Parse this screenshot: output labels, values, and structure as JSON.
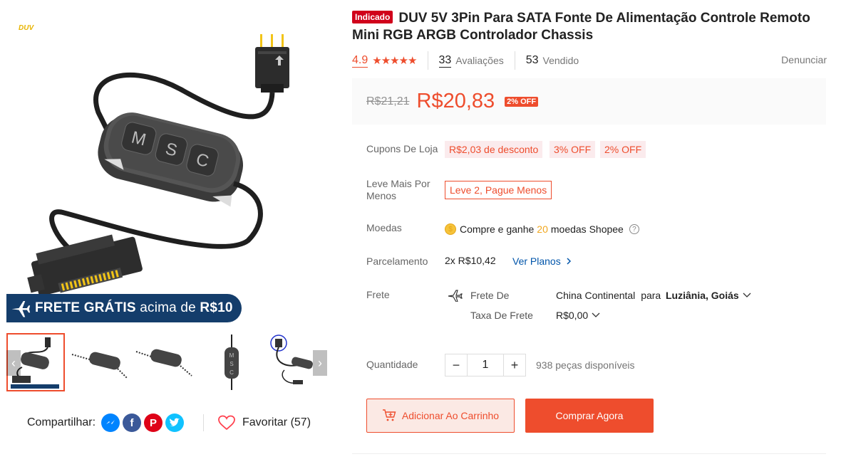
{
  "gallery": {
    "watermark": "DUV",
    "banner": {
      "strong": "FRETE GRÁTIS",
      "light": "acima de",
      "amount": "R$10"
    },
    "thumbnail_count": 5,
    "share_label": "Compartilhar:",
    "share_icons": [
      "messenger-icon",
      "facebook-icon",
      "pinterest-icon",
      "twitter-icon"
    ],
    "favorite_label": "Favoritar (57)"
  },
  "product": {
    "badge": "Indicado",
    "title": "DUV 5V 3Pin Para SATA Fonte De Alimentação Controle Remoto Mini RGB ARGB Controlador Chassis",
    "rating": "4.9",
    "stars": 5,
    "reviews_count": "33",
    "reviews_label": "Avaliações",
    "sold_count": "53",
    "sold_label": "Vendido",
    "report_label": "Denunciar"
  },
  "price": {
    "old": "R$21,21",
    "current": "R$20,83",
    "discount": "2% OFF"
  },
  "coupons": {
    "label": "Cupons De Loja",
    "items": [
      "R$2,03 de desconto",
      "3% OFF",
      "2% OFF"
    ]
  },
  "bundle": {
    "label_line1": "Leve Mais Por",
    "label_line2": "Menos",
    "badge": "Leve 2, Pague Menos"
  },
  "coins": {
    "label": "Moedas",
    "before": "Compre e ganhe",
    "amount": "20",
    "after": "moedas Shopee"
  },
  "installments": {
    "label": "Parcelamento",
    "value": "2x R$10,42",
    "link": "Ver Planos"
  },
  "shipping": {
    "label": "Frete",
    "from_label": "Frete De",
    "origin": "China Continental",
    "to": "para",
    "destination": "Luziânia, Goiás",
    "fee_label": "Taxa De Frete",
    "fee": "R$0,00"
  },
  "quantity": {
    "label": "Quantidade",
    "value": "1",
    "available": "938 peças disponíveis"
  },
  "actions": {
    "add_to_cart": "Adicionar Ao Carrinho",
    "buy_now": "Comprar Agora"
  },
  "colors": {
    "accent": "#ee4d2d",
    "banner": "#143d6b",
    "link": "#0055aa"
  }
}
